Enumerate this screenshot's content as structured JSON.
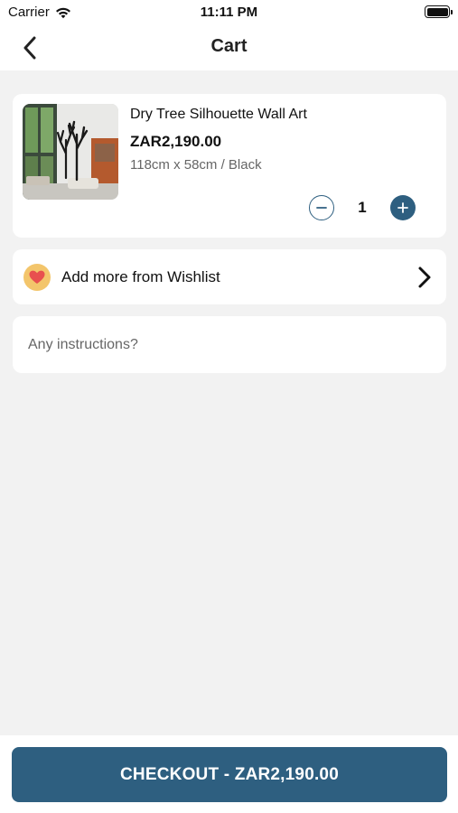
{
  "status_bar": {
    "carrier": "Carrier",
    "time": "11:11 PM",
    "wifi_icon": "wifi-icon",
    "battery_icon": "battery-icon",
    "battery_level": 1.0
  },
  "nav": {
    "title": "Cart",
    "back_icon": "chevron-left-icon"
  },
  "cart": {
    "items": [
      {
        "name": "Dry Tree Silhouette Wall Art",
        "price": "ZAR2,190.00",
        "variant": "118cm x 58cm / Black",
        "quantity": "1",
        "image_icon": "product-photo",
        "minus_icon": "minus-circle-icon",
        "plus_icon": "plus-circle-icon"
      }
    ]
  },
  "wishlist": {
    "label": "Add more from Wishlist",
    "icon": "heart-icon",
    "chevron_icon": "chevron-right-icon"
  },
  "instructions": {
    "placeholder": "Any instructions?",
    "value": ""
  },
  "checkout": {
    "label": "CHECKOUT - ZAR2,190.00"
  },
  "colors": {
    "accent": "#2e5f80",
    "background": "#f2f2f2",
    "card": "#ffffff",
    "wishlist_badge": "#f3c56b",
    "heart": "#e8504f"
  }
}
